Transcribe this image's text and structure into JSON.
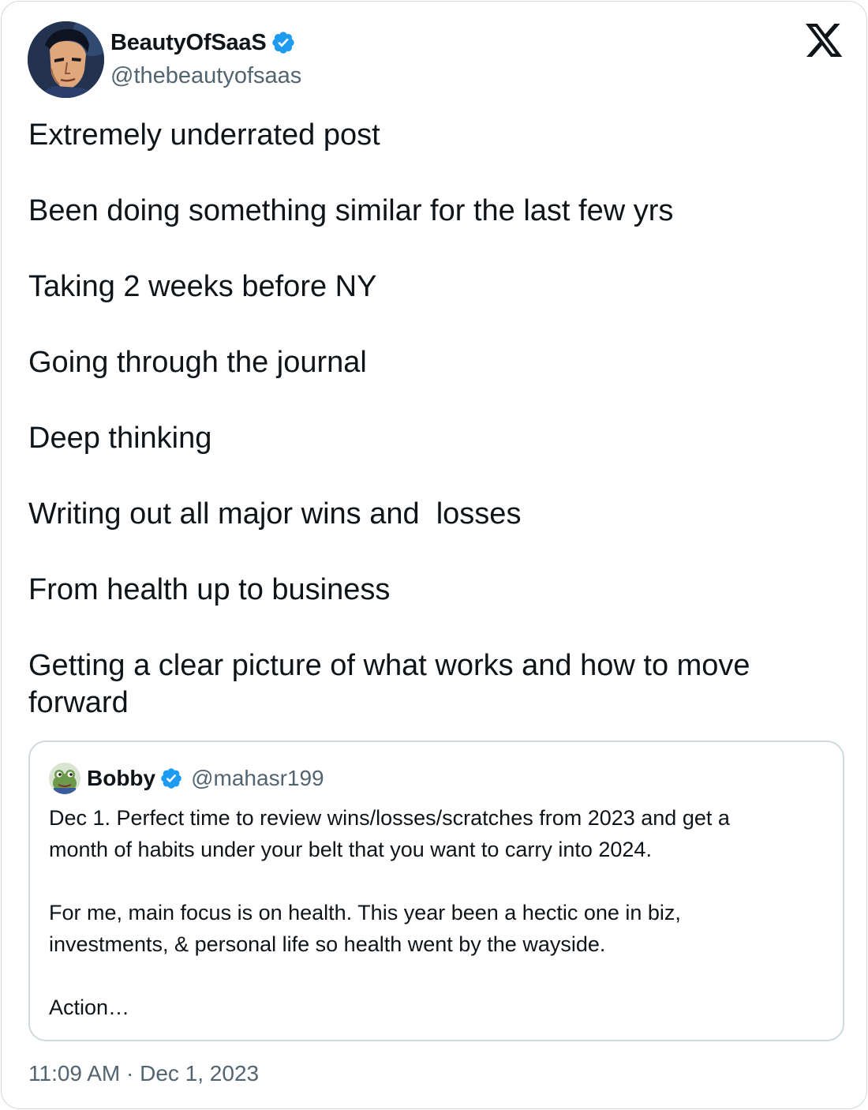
{
  "author": {
    "name": "BeautyOfSaaS",
    "handle": "@thebeautyofsaas",
    "verified": true,
    "avatar_icon": "comic-hero-portrait-avatar"
  },
  "platform": {
    "logo_icon": "x-logo-icon"
  },
  "tweet": {
    "lines": [
      "Extremely underrated post",
      "Been doing something similar for the last few yrs",
      "Taking 2 weeks before NY",
      "Going through the journal",
      "Deep thinking",
      "Writing out all major wins and  losses",
      "From health up to business",
      "Getting a clear picture of what works and how to move",
      "forward"
    ]
  },
  "quoted_tweet": {
    "name": "Bobby",
    "handle": "@mahasr199",
    "verified": true,
    "avatar_icon": "frog-avatar",
    "lines": [
      "Dec 1. Perfect time to review wins/losses/scratches from 2023 and get a",
      "month of habits under your belt that you want to carry into 2024.",
      "For me, main focus is on health. This year been a hectic one in biz,",
      "investments, & personal life so health went by the wayside.",
      "Action…"
    ]
  },
  "timestamp": "11:09 AM · Dec 1, 2023",
  "colors": {
    "text_primary": "#0f1419",
    "text_secondary": "#536471",
    "border": "#cfd9de",
    "verified_blue": "#1d9bf0"
  }
}
